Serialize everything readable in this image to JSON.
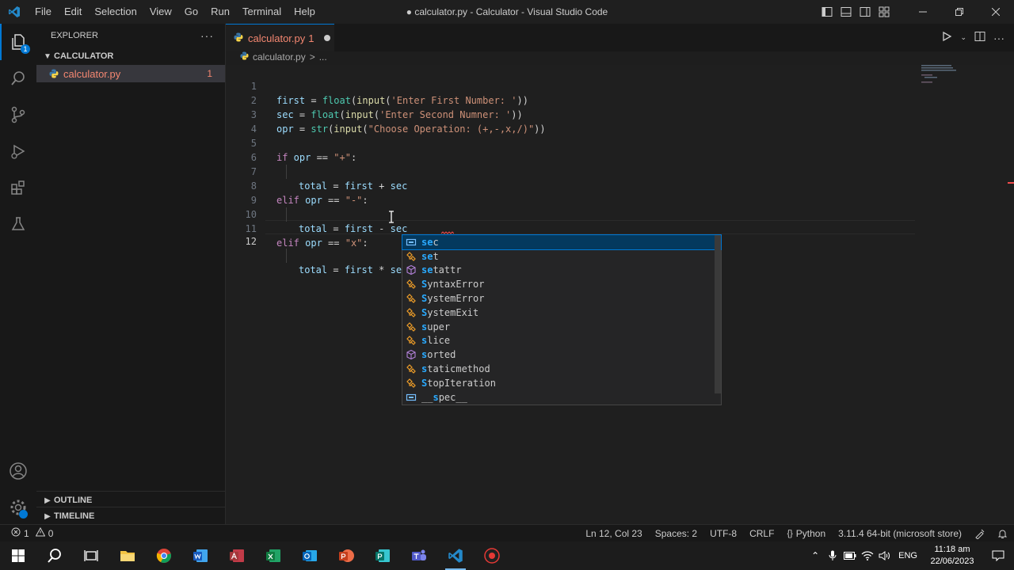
{
  "titlebar": {
    "menu": [
      "File",
      "Edit",
      "Selection",
      "View",
      "Go",
      "Run",
      "Terminal",
      "Help"
    ],
    "window_title": "● calculator.py - Calculator - Visual Studio Code"
  },
  "sidebar": {
    "header": "EXPLORER",
    "more": "···",
    "folder": "CALCULATOR",
    "file": {
      "name": "calculator.py",
      "count": "1"
    },
    "outline": "OUTLINE",
    "timeline": "TIMELINE"
  },
  "tab": {
    "label": "calculator.py",
    "errors": "1"
  },
  "breadcrumb": {
    "file": "calculator.py",
    "sep": ">",
    "rest": "..."
  },
  "code": {
    "line_numbers": [
      "1",
      "2",
      "3",
      "4",
      "5",
      "6",
      "7",
      "8",
      "9",
      "10",
      "11",
      "12"
    ],
    "lines": {
      "l1": {
        "a": "first",
        "b": " = ",
        "c": "float",
        "d": "(",
        "e": "input",
        "f": "(",
        "g": "'Enter First Number: '",
        "h": "))"
      },
      "l2": {
        "a": "sec",
        "b": " = ",
        "c": "float",
        "d": "(",
        "e": "input",
        "f": "(",
        "g": "'Enter Second Numner: '",
        "h": "))"
      },
      "l3": {
        "a": "opr",
        "b": " = ",
        "c": "str",
        "d": "(",
        "e": "input",
        "f": "(",
        "g": "\"Choose Operation: (+,-,x,/)\"",
        "h": "))"
      },
      "l5": {
        "kw": "if",
        "v": " opr",
        "op": " == ",
        "s": "\"+\"",
        "c": ":"
      },
      "l6": {
        "v1": "total",
        "op1": " = ",
        "v2": "first",
        "op2": " + ",
        "v3": "sec"
      },
      "l8": {
        "kw": "elif",
        "v": " opr",
        "op": " == ",
        "s": "\"-\"",
        "c": ":"
      },
      "l9": {
        "v1": "total",
        "op1": " = ",
        "v2": "first",
        "op2": " - ",
        "v3": "sec"
      },
      "l11": {
        "kw": "elif",
        "v": " opr",
        "op": " == ",
        "s": "\"x\"",
        "c": ":"
      },
      "l12": {
        "v1": "total",
        "op1": " = ",
        "v2": "first",
        "op2": " * ",
        "v3": "se"
      }
    }
  },
  "suggestions": [
    {
      "pre": "",
      "hl": "se",
      "post": "c",
      "kind": "variable"
    },
    {
      "pre": "",
      "hl": "se",
      "post": "t",
      "kind": "class"
    },
    {
      "pre": "",
      "hl": "se",
      "post": "tattr",
      "kind": "function"
    },
    {
      "pre": "",
      "hl": "S",
      "post": "yntaxError",
      "kind": "class",
      "hl2": "",
      "post2": ""
    },
    {
      "pre": "",
      "hl": "S",
      "post": "ystemError",
      "kind": "class"
    },
    {
      "pre": "",
      "hl": "S",
      "post": "ystemExit",
      "kind": "class"
    },
    {
      "pre": "",
      "hl": "s",
      "post": "uper",
      "kind": "class"
    },
    {
      "pre": "",
      "hl": "s",
      "post": "lice",
      "kind": "class"
    },
    {
      "pre": "",
      "hl": "s",
      "post": "orted",
      "kind": "function"
    },
    {
      "pre": "",
      "hl": "s",
      "post": "taticmethod",
      "kind": "class"
    },
    {
      "pre": "",
      "hl": "S",
      "post": "topIteration",
      "kind": "class"
    },
    {
      "pre": "__",
      "hl": "s",
      "post": "pec__",
      "kind": "variable"
    }
  ],
  "statusbar": {
    "errors": "1",
    "warnings": "0",
    "position": "Ln 12, Col 23",
    "spaces": "Spaces: 2",
    "encoding": "UTF-8",
    "eol": "CRLF",
    "language": "Python",
    "interpreter": "3.11.4 64-bit (microsoft store)"
  },
  "taskbar": {
    "lang": "ENG",
    "time": "11:18 am",
    "date": "22/06/2023"
  },
  "colors": {
    "accent": "#0078d4",
    "error": "#f48771",
    "editor_bg": "#1f1f1f"
  }
}
